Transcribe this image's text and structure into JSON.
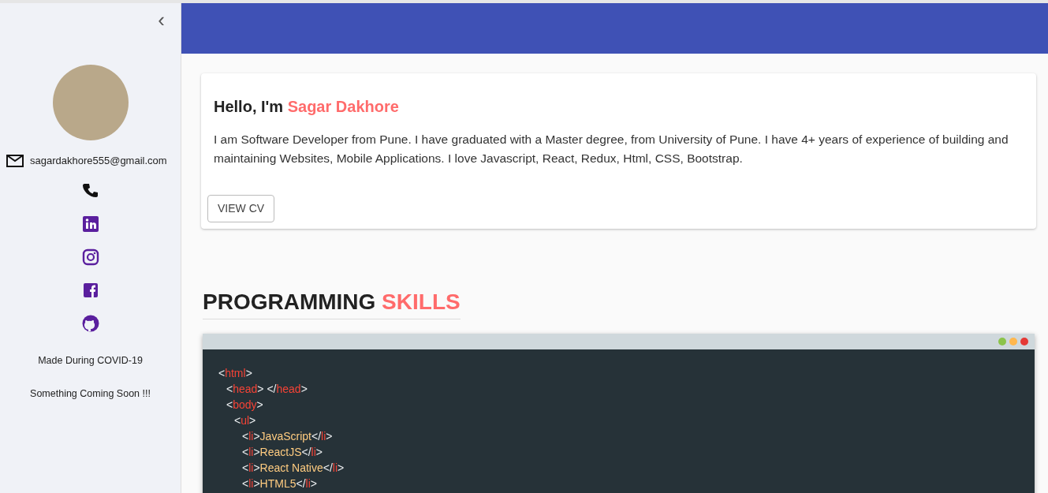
{
  "sidebar": {
    "collapse_icon": "‹",
    "email": "sagardakhore555@gmail.com",
    "footer": [
      "Made During COVID-19",
      "Something Coming Soon !!!"
    ]
  },
  "intro": {
    "greeting": "Hello, I'm",
    "name": "Sagar Dakhore",
    "text": "I am Software Developer from Pune. I have graduated with a Master degree, from University of Pune. I have 4+ years of experience of building and maintaining Websites, Mobile Applications. I love Javascript, React, Redux, Html, CSS, Bootstrap.",
    "button": "VIEW CV"
  },
  "skills": {
    "title_start": "PROGRAMMING",
    "title_accent": "SKILLS",
    "window_dots": [
      {
        "color": "#8bc34a"
      },
      {
        "color": "#ffb74d"
      },
      {
        "color": "#e53935"
      }
    ],
    "code": [
      {
        "tokens": [
          {
            "kind": "punct",
            "text": "<"
          },
          {
            "kind": "tag",
            "text": "html"
          },
          {
            "kind": "punct",
            "text": ">"
          }
        ],
        "children": [
          {
            "tokens": [
              {
                "kind": "punct",
                "text": "<"
              },
              {
                "kind": "tag",
                "text": "head"
              },
              {
                "kind": "punct",
                "text": "> </"
              },
              {
                "kind": "tag",
                "text": "head"
              },
              {
                "kind": "punct",
                "text": ">"
              }
            ]
          },
          {
            "tokens": [
              {
                "kind": "punct",
                "text": "<"
              },
              {
                "kind": "tag",
                "text": "body"
              },
              {
                "kind": "punct",
                "text": ">"
              }
            ],
            "children": [
              {
                "tokens": [
                  {
                    "kind": "punct",
                    "text": "<"
                  },
                  {
                    "kind": "tag",
                    "text": "ul"
                  },
                  {
                    "kind": "punct",
                    "text": ">"
                  }
                ],
                "children": [
                  {
                    "tokens": [
                      {
                        "kind": "punct",
                        "text": "<"
                      },
                      {
                        "kind": "tag",
                        "text": "li"
                      },
                      {
                        "kind": "punct",
                        "text": ">"
                      },
                      {
                        "kind": "value",
                        "text": "JavaScript"
                      },
                      {
                        "kind": "punct",
                        "text": "</"
                      },
                      {
                        "kind": "tag",
                        "text": "li"
                      },
                      {
                        "kind": "punct",
                        "text": ">"
                      }
                    ]
                  },
                  {
                    "tokens": [
                      {
                        "kind": "punct",
                        "text": "<"
                      },
                      {
                        "kind": "tag",
                        "text": "li"
                      },
                      {
                        "kind": "punct",
                        "text": ">"
                      },
                      {
                        "kind": "value",
                        "text": "ReactJS"
                      },
                      {
                        "kind": "punct",
                        "text": "</"
                      },
                      {
                        "kind": "tag",
                        "text": "li"
                      },
                      {
                        "kind": "punct",
                        "text": ">"
                      }
                    ]
                  },
                  {
                    "tokens": [
                      {
                        "kind": "punct",
                        "text": "<"
                      },
                      {
                        "kind": "tag",
                        "text": "li"
                      },
                      {
                        "kind": "punct",
                        "text": ">"
                      },
                      {
                        "kind": "value",
                        "text": "React Native"
                      },
                      {
                        "kind": "punct",
                        "text": "</"
                      },
                      {
                        "kind": "tag",
                        "text": "li"
                      },
                      {
                        "kind": "punct",
                        "text": ">"
                      }
                    ]
                  },
                  {
                    "tokens": [
                      {
                        "kind": "punct",
                        "text": "<"
                      },
                      {
                        "kind": "tag",
                        "text": "li"
                      },
                      {
                        "kind": "punct",
                        "text": ">"
                      },
                      {
                        "kind": "value",
                        "text": "HTML5"
                      },
                      {
                        "kind": "punct",
                        "text": "</"
                      },
                      {
                        "kind": "tag",
                        "text": "li"
                      },
                      {
                        "kind": "punct",
                        "text": ">"
                      }
                    ]
                  }
                ]
              }
            ]
          }
        ]
      }
    ]
  }
}
